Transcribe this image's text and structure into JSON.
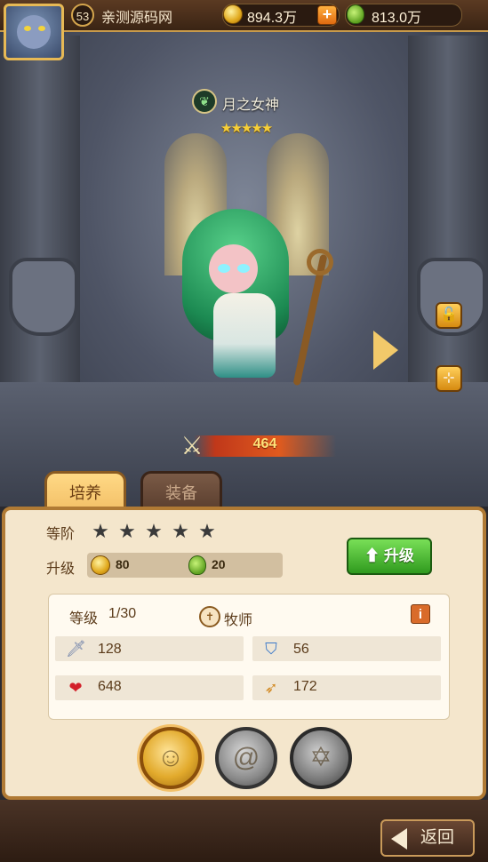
{
  "topbar": {
    "player_level": "53",
    "player_name": "亲测源码网",
    "gold": "894.3万",
    "plus_label": "+",
    "potion": "813.0万",
    "avatar_icon": "player-avatar-icon"
  },
  "hero": {
    "name": "月之女神",
    "stars": "★★★★★",
    "class_icon": "leaf-icon",
    "power": "464"
  },
  "side_buttons": {
    "lock_icon": "unlock-icon",
    "share_icon": "share-icon",
    "next_icon": "chevron-right-icon"
  },
  "tabs": [
    {
      "label": "培养",
      "active": true
    },
    {
      "label": "装备",
      "active": false
    }
  ],
  "panel": {
    "rank_label": "等阶",
    "rank_stars": [
      "★",
      "★",
      "★",
      "★",
      "★"
    ],
    "upgrade_label": "升级",
    "cost_gold": "80",
    "cost_potion": "20",
    "upgrade_button": "升级",
    "level_label": "等级",
    "level_value": "1/30",
    "class_name": "牧师",
    "info_icon": "i",
    "stats": {
      "attack": "128",
      "defense": "56",
      "hp": "648",
      "speed": "172"
    }
  },
  "skills": [
    "skill-gold-icon",
    "skill-spiral-icon",
    "skill-hexagram-icon"
  ],
  "back_button": "返回",
  "colors": {
    "accent_gold": "#f3c068",
    "upgrade_green": "#2f9a1e",
    "panel_bg": "#f4e6cc"
  }
}
